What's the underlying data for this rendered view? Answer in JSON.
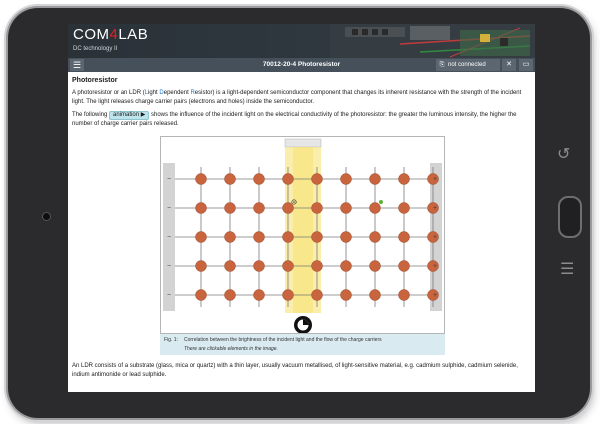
{
  "app": {
    "logo_left": "COM",
    "logo_mid": "4",
    "logo_right": "LAB",
    "course": "DC technology II"
  },
  "toolbar": {
    "menu_icon": "menu-icon",
    "title": "70012-20-4  Photoresistor",
    "status": "not connected"
  },
  "content": {
    "heading": "Photoresistor",
    "para1_a": "A photoresistor or an LDR (",
    "para1_l": "L",
    "para1_ight": "ight ",
    "para1_d": "D",
    "para1_ependent": "ependent ",
    "para1_r": "R",
    "para1_b": "esistor) is a light-dependent semiconductor component that changes its inherent resistance with the strength of the incident light. The light releases charge carrier pairs (electrons and holes) inside the semiconductor.",
    "para2_a": "The following",
    "anim_label": "animation ▶",
    "para2_b": "shows the influence of the incident light on the electrical conductivity of the photoresistor: the greater the luminous intensity, the higher the number of charge carrier pairs released.",
    "para3": "An LDR consists of a substrate (glass, mica or quartz) with a thin layer, usually vacuum metallised, of light-sensitive material, e.g. cadmium sulphide, cadmium selenide, indium antimonide or lead sulphide."
  },
  "figure": {
    "rows": 5,
    "cols": 9,
    "minus": "−",
    "plus": "+",
    "colors": {
      "atom": "#c8643e",
      "bond": "#7a7a7a",
      "light": "#f5e06a",
      "electrode": "#d3d3d3",
      "hole_marker": "#5cb531"
    }
  },
  "caption": {
    "number": "Fig. 1:",
    "text": "Correlation between the brightness of the incident light and the flow of the charge carriers",
    "note": "There are clickable elements in the image."
  }
}
